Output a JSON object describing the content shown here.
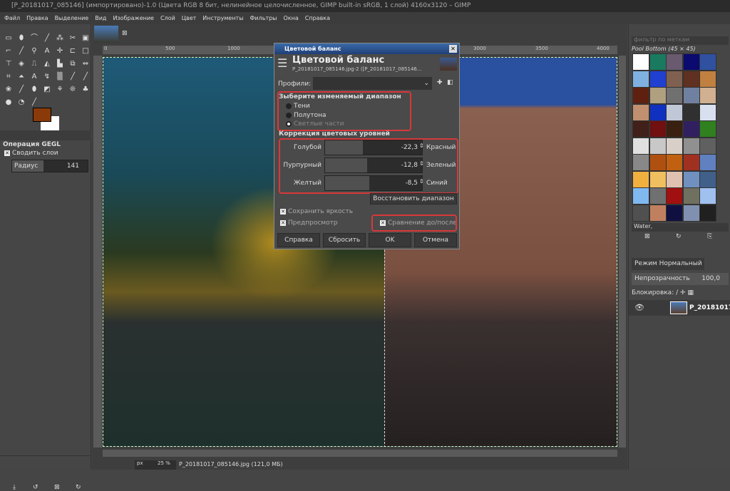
{
  "window": {
    "title": "[P_20181017_085146] (импортировано)-1.0 (Цвета RGB 8 бит, нелинейное целочисленное, GIMP built-in sRGB, 1 слой) 4160x3120 – GIMP"
  },
  "menu": [
    "Файл",
    "Правка",
    "Выделение",
    "Вид",
    "Изображение",
    "Слой",
    "Цвет",
    "Инструменты",
    "Фильтры",
    "Окна",
    "Справка"
  ],
  "colors": {
    "foreground": "#8a3a08",
    "background": "#ffffff",
    "accent": "#d8383a"
  },
  "tool_options": {
    "title": "Операция GEGL",
    "merge_label": "Сводить слои",
    "radius_label": "Радиус",
    "radius_value": "141"
  },
  "ruler": {
    "ticks": [
      "0",
      "500",
      "1000",
      "3000",
      "3500",
      "4000"
    ]
  },
  "status": {
    "unit": "px",
    "zoom": "25 %",
    "file": "P_20181017_085146.jpg (121,0 МБ)"
  },
  "patterns": {
    "filter_placeholder": "фильтр по меткам",
    "name": "Pool Bottom (45 × 45)",
    "tag": "Water,",
    "swatches": [
      "#ffffff",
      "#1a7a60",
      "#6a5a70",
      "#0a0a70",
      "#3050a0",
      "#80b0e0",
      "#2040d0",
      "#806050",
      "#603020",
      "#c08040",
      "#602010",
      "#b0a080",
      "#707070",
      "#7080a0",
      "#d0b090",
      "#c09070",
      "#1030c0",
      "#c0c8d8",
      "#303030",
      "#d8e0f0",
      "#402018",
      "#701010",
      "#3a2010",
      "#302060",
      "#308020",
      "#e0e0e0",
      "#c8c8c8",
      "#d8d0c8",
      "#909090",
      "#606060",
      "#888888",
      "#b05010",
      "#c06010",
      "#a03020",
      "#6080c0",
      "#f0b040",
      "#f0c060",
      "#e0c0b0",
      "#7090c0",
      "#40608a",
      "#80b8f0",
      "#707070",
      "#a01010",
      "#707060",
      "#a0c0f0",
      "#505050",
      "#c08060",
      "#101040",
      "#8090b0",
      "#202020"
    ]
  },
  "layers": {
    "mode": "Режим Нормальный",
    "opacity_label": "Непрозрачность",
    "opacity_value": "100,0",
    "lock_label": "Блокировка:",
    "layer_name": "P_20181017"
  },
  "dialog": {
    "window_title": "Цветовой баланс",
    "heading": "Цветовой баланс",
    "subtitle": "P_20181017_085146.jpg-2 ([P_20181017_085146...",
    "profiles_label": "Профили:",
    "range_title": "Зыберите изменяемый диапазон",
    "ranges": [
      {
        "label": "Тени",
        "selected": false
      },
      {
        "label": "Полутона",
        "selected": false
      },
      {
        "label": "Светлые части",
        "selected": true
      }
    ],
    "correction_title": "Коррекция цветовых уровней",
    "sliders": [
      {
        "left": "Голубой",
        "right": "Красный",
        "value": "-22,3",
        "fraction": 0.389
      },
      {
        "left": "Пурпурный",
        "right": "Зеленый",
        "value": "-12,8",
        "fraction": 0.436
      },
      {
        "left": "Желтый",
        "right": "Синий",
        "value": "-8,5",
        "fraction": 0.458
      }
    ],
    "reset_range": "Восстановить диапазон",
    "preserve": "Сохранить яркость",
    "preview": "Предпросмотр",
    "compare": "Сравнение до/после",
    "buttons": {
      "help": "Справка",
      "reset": "Сбросить",
      "ok": "OK",
      "cancel": "Отмена"
    }
  }
}
